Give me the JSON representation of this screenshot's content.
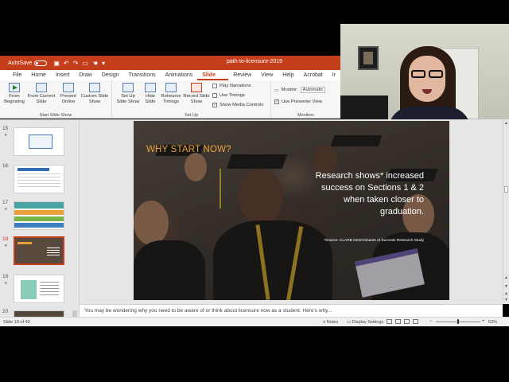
{
  "app": {
    "autosave_label": "AutoSave",
    "autosave_state": "Off",
    "doc_title": "path-to-licensure-2019"
  },
  "tabs": [
    "File",
    "Home",
    "Insert",
    "Draw",
    "Design",
    "Transitions",
    "Animations",
    "Slide Show",
    "Review",
    "View",
    "Help",
    "Acrobat",
    "Ir"
  ],
  "active_tab": "Slide Show",
  "ribbon": {
    "from_beginning": "From Beginning",
    "from_current": "From Current Slide",
    "present_online": "Present Online",
    "custom_slide_show": "Custom Slide Show",
    "group_start": "Start Slide Show",
    "set_up_show": "Set Up Slide Show",
    "hide_slide": "Hide Slide",
    "rehearse_timings": "Rehearse Timings",
    "record_slide_show": "Record Slide Show",
    "play_narrations": "Play Narrations",
    "use_timings": "Use Timings",
    "show_media_controls": "Show Media Controls",
    "group_setup": "Set Up",
    "monitor_label": "Monitor:",
    "monitor_value": "Automatic",
    "use_presenter_view": "Use Presenter View",
    "group_monitors": "Monitors"
  },
  "thumbnails": [
    {
      "num": "15",
      "starred": true
    },
    {
      "num": "16",
      "starred": false
    },
    {
      "num": "17",
      "starred": true
    },
    {
      "num": "18",
      "starred": true,
      "active": true
    },
    {
      "num": "19",
      "starred": true
    },
    {
      "num": "20",
      "starred": false
    }
  ],
  "slide": {
    "heading": "WHY START NOW?",
    "body": "Research shows* increased success on Sections 1 & 2 when taken closer to graduation.",
    "source": "*Source: CLARB Determinants of Success Research Study"
  },
  "notes": "You may be wondering why you need to be aware of or think about licensure now as a student. Here's why...",
  "status": {
    "slide_counter": "Slide 18 of 40",
    "notes_label": "Notes",
    "display_settings": "Display Settings",
    "zoom": "63%",
    "zoom_fraction": 0.5
  },
  "colors": {
    "brand": "#c43e1c",
    "heading_orange": "#e8a03a"
  }
}
